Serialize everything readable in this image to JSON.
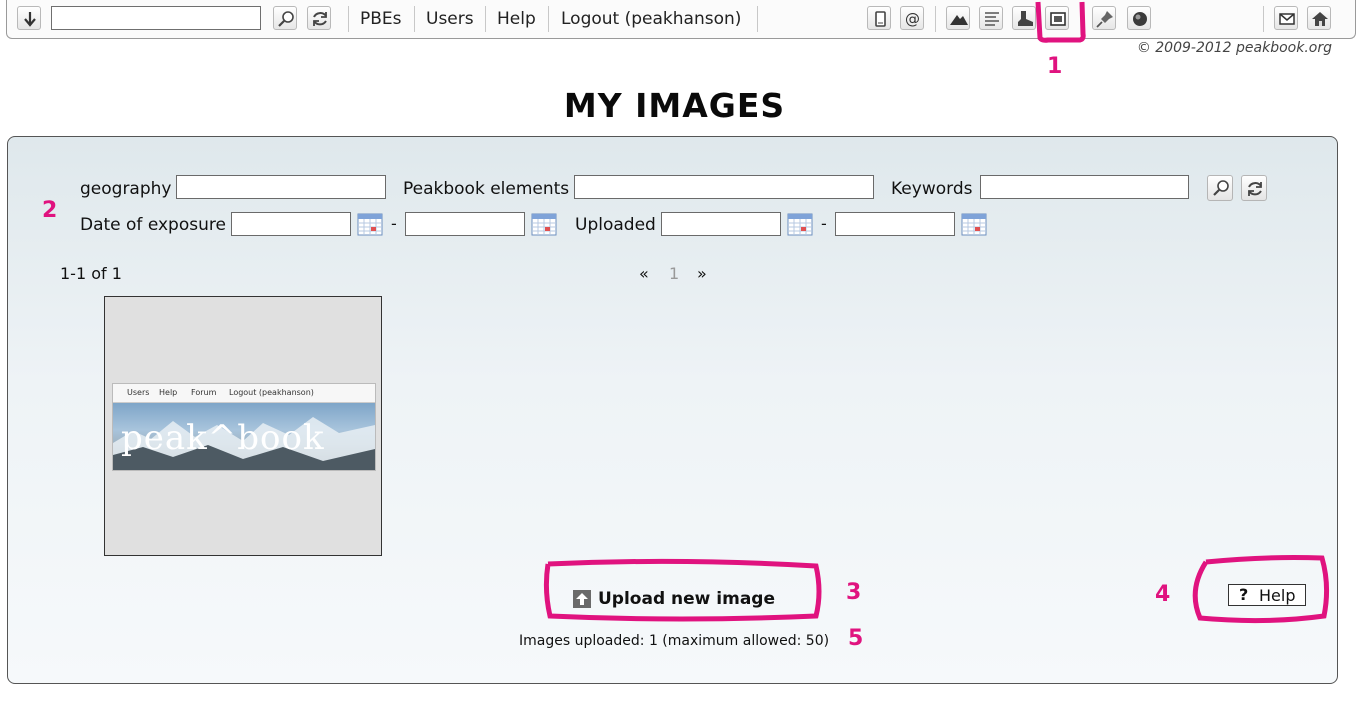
{
  "toolbar": {
    "search_placeholder": "",
    "links": {
      "pbes": "PBEs",
      "users": "Users",
      "help": "Help",
      "logout": "Logout (peakhanson)"
    },
    "icons": [
      "download-icon",
      "search-icon",
      "refresh-icon",
      "phone-icon",
      "at-icon",
      "mountain-icon",
      "list-icon",
      "boot-icon",
      "image-icon",
      "pin-icon",
      "globe-icon",
      "mail-icon",
      "home-icon"
    ]
  },
  "copyright": "© 2009-2012 peakbook.org",
  "annotations": {
    "a1": "1",
    "a2": "2",
    "a3": "3",
    "a4": "4",
    "a5": "5",
    "color": "#e0137f"
  },
  "page_title": "MY IMAGES",
  "filters": {
    "geography_label": "geography",
    "geography_value": "",
    "elements_label": "Peakbook elements",
    "elements_value": "",
    "keywords_label": "Keywords",
    "keywords_value": "",
    "exposure_label": "Date of exposure",
    "exposure_from": "",
    "exposure_to": "",
    "uploaded_label": "Uploaded",
    "uploaded_from": "",
    "uploaded_to": "",
    "range_separator": "-"
  },
  "pager": {
    "count": "1-1 of 1",
    "prev": "«",
    "current": "1",
    "next": "»"
  },
  "thumbnail": {
    "nav_items": [
      "Users",
      "Help",
      "Forum",
      "Logout (peakhanson)"
    ],
    "logo_text": "peak^book"
  },
  "upload_button": "Upload new image",
  "help_button": {
    "icon": "?",
    "label": "Help"
  },
  "images_uploaded": "Images uploaded: 1 (maximum allowed: 50)"
}
